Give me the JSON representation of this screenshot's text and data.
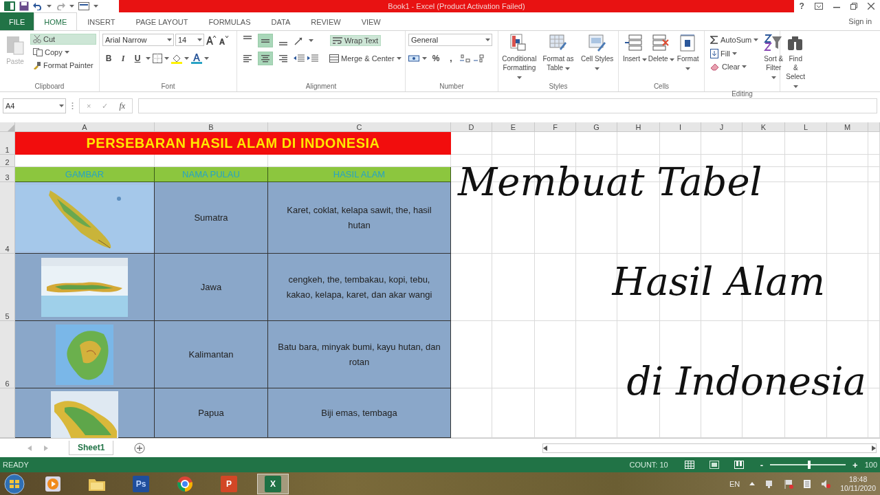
{
  "window": {
    "title": "Book1 - Excel (Product Activation Failed)",
    "help": "?"
  },
  "tabs": [
    {
      "label": "FILE",
      "kind": "file",
      "selected": false
    },
    {
      "label": "HOME",
      "kind": "tab",
      "selected": true
    },
    {
      "label": "INSERT",
      "kind": "tab",
      "selected": false
    },
    {
      "label": "PAGE LAYOUT",
      "kind": "tab",
      "selected": false
    },
    {
      "label": "FORMULAS",
      "kind": "tab",
      "selected": false
    },
    {
      "label": "DATA",
      "kind": "tab",
      "selected": false
    },
    {
      "label": "REVIEW",
      "kind": "tab",
      "selected": false
    },
    {
      "label": "VIEW",
      "kind": "tab",
      "selected": false
    }
  ],
  "account": {
    "sign_in": "Sign in"
  },
  "ribbon": {
    "clipboard": {
      "label": "Clipboard",
      "paste": {
        "label": "Paste",
        "disabled": true
      },
      "cut": {
        "label": "Cut",
        "highlighted": true
      },
      "copy": {
        "label": "Copy"
      },
      "format_painter": {
        "label": "Format Painter"
      }
    },
    "font": {
      "label": "Font",
      "font_name": "Arial Narrow",
      "font_size": "14",
      "styles": [
        "B",
        "I",
        "U"
      ]
    },
    "alignment": {
      "label": "Alignment",
      "vertical": [
        {
          "selected": false
        },
        {
          "selected": true
        },
        {
          "selected": false
        }
      ],
      "horizontal": [
        {
          "selected": false
        },
        {
          "selected": true
        },
        {
          "selected": false
        }
      ],
      "wrap_text": {
        "label": "Wrap Text",
        "selected": true
      },
      "merge": {
        "label": "Merge & Center"
      }
    },
    "number": {
      "label": "Number",
      "format": "General",
      "percent": "%",
      "comma": ","
    },
    "styles": {
      "label": "Styles",
      "buttons": [
        {
          "label": "Conditional Formatting",
          "kind": "conditional"
        },
        {
          "label": "Format as Table",
          "kind": "table"
        },
        {
          "label": "Cell Styles",
          "kind": "styles"
        }
      ]
    },
    "cells": {
      "label": "Cells",
      "buttons": [
        {
          "label": "Insert",
          "kind": "insert"
        },
        {
          "label": "Delete",
          "kind": "delete"
        },
        {
          "label": "Format",
          "kind": "format"
        }
      ]
    },
    "editing": {
      "label": "Editing",
      "autosum": "AutoSum",
      "fill": "Fill",
      "clear": "Clear",
      "buttons": [
        {
          "label": "Sort & Filter",
          "kind": "sort"
        },
        {
          "label": "Find & Select",
          "kind": "find"
        }
      ]
    }
  },
  "formula_bar": {
    "name_box": "A4",
    "cancel": "×",
    "enter": "✓",
    "function": "fx"
  },
  "sheet": {
    "columns": [
      "A",
      "B",
      "C",
      "D",
      "E",
      "F",
      "G",
      "H",
      "I",
      "J",
      "K",
      "L",
      "M"
    ],
    "row_numbers": [
      "1",
      "2",
      "3",
      "4",
      "5",
      "6"
    ],
    "title": "PERSEBARAN HASIL ALAM DI INDONESIA",
    "headers": [
      "GAMBAR",
      "NAMA PULAU",
      "HASIL ALAM"
    ],
    "rows": [
      {
        "island": "Sumatra",
        "resources": "Karet, coklat, kelapa sawit, the, hasil hutan"
      },
      {
        "island": "Jawa",
        "resources": "cengkeh, the, tembakau, kopi, tebu, kakao, kelapa, karet, dan akar wangi"
      },
      {
        "island": "Kalimantan",
        "resources": "Batu bara, minyak bumi, kayu hutan, dan rotan"
      },
      {
        "island": "Papua",
        "resources": "Biji emas, tembaga"
      }
    ]
  },
  "overlay_title": [
    "Membuat Tabel",
    "Hasil Alam",
    "di Indonesia"
  ],
  "sheet_tabs": [
    {
      "label": "Sheet1",
      "selected": true
    }
  ],
  "status_bar": {
    "status": "READY",
    "count": "COUNT: 10",
    "zoom_out": "-",
    "zoom_in": "+",
    "zoom": {
      "level": 0.52
    },
    "zoom_label": "100"
  },
  "taskbar": {
    "apps": [
      {
        "kind": "media",
        "selected": false
      },
      {
        "kind": "folder",
        "selected": false
      },
      {
        "kind": "photoshop",
        "label": "Ps",
        "selected": false
      },
      {
        "kind": "chrome",
        "selected": false
      },
      {
        "kind": "powerpoint",
        "label": "P",
        "selected": false
      },
      {
        "kind": "excel",
        "label": "X",
        "selected": true
      }
    ],
    "language": "EN",
    "time": "18:48",
    "date": "10/11/2020"
  }
}
